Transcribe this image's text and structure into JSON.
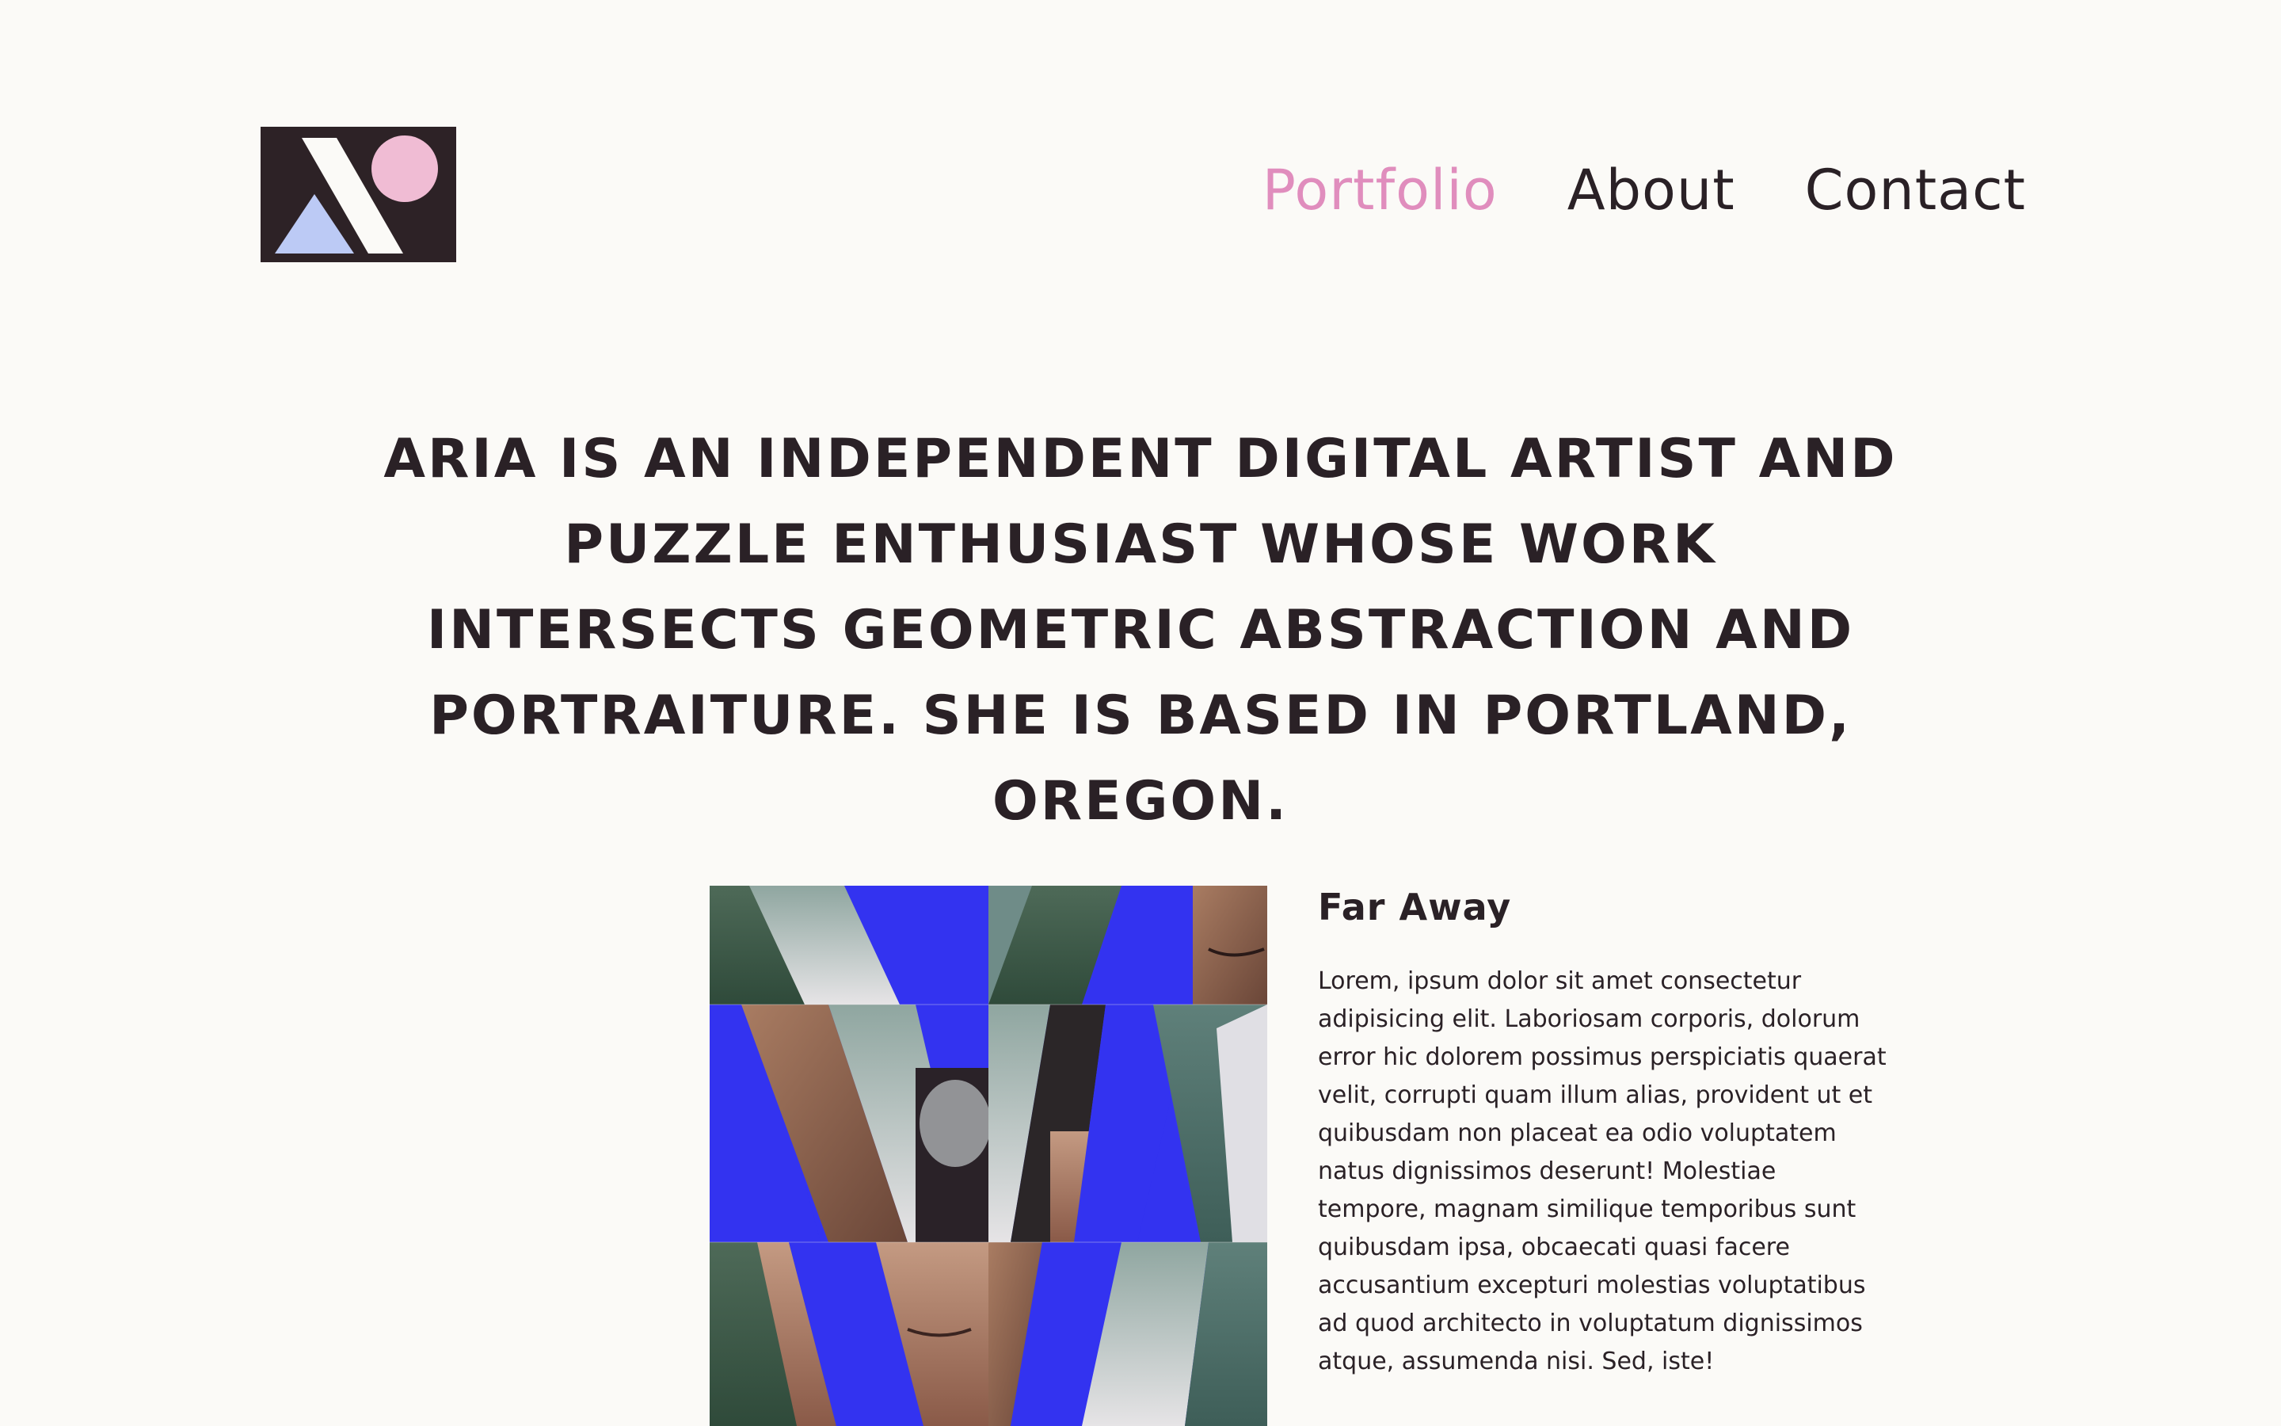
{
  "header": {
    "logo_icon": "aria-monogram-logo",
    "nav": [
      {
        "label": "Portfolio",
        "active": true
      },
      {
        "label": "About",
        "active": false
      },
      {
        "label": "Contact",
        "active": false
      }
    ]
  },
  "intro": {
    "statement": "Aria is an independent digital artist and puzzle enthusiast whose work intersects geometric abstraction and portraiture. She is based in Portland, Oregon."
  },
  "featured": {
    "title": "Far Away",
    "description": "Lorem, ipsum dolor sit amet consectetur adipisicing elit. Laboriosam corporis, dolorum error hic dolorem possimus perspiciatis quaerat velit, corrupti quam illum alias, provident ut et quibusdam non placeat ea odio voluptatem natus dignissimos deserunt! Molestiae tempore, magnam similique temporibus sunt quibusdam ipsa, obcaecati quasi facere accusantium excepturi molestias voluptatibus ad quod architecto in voluptatum dignissimos atque, assumenda nisi. Sed, iste!",
    "artwork_icon": "geometric-portrait-artwork"
  },
  "colors": {
    "background": "#fbfaf7",
    "text": "#2a2126",
    "accent_pink": "#e08dbd",
    "logo_pink": "#f0bcd4",
    "logo_blue": "#bccaf5",
    "art_blue": "#3333f0"
  }
}
